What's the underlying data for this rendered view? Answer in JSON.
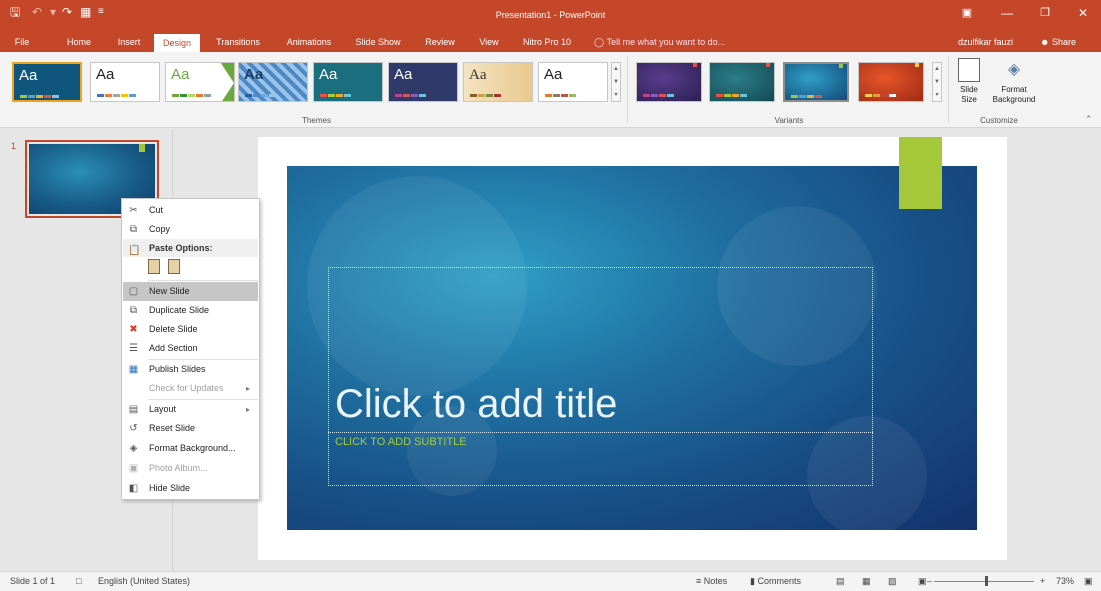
{
  "window": {
    "title": "Presentation1  -  PowerPoint",
    "user_name": "dzulfikar fauzi",
    "share_label": "Share"
  },
  "tabs": [
    {
      "label": "File"
    },
    {
      "label": "Home"
    },
    {
      "label": "Insert"
    },
    {
      "label": "Design",
      "active": true
    },
    {
      "label": "Transitions"
    },
    {
      "label": "Animations"
    },
    {
      "label": "Slide Show"
    },
    {
      "label": "Review"
    },
    {
      "label": "View"
    },
    {
      "label": "Nitro Pro 10"
    }
  ],
  "tell_me": "Tell me what you want to do...",
  "ribbon": {
    "themes_label": "Themes",
    "variants_label": "Variants",
    "customize_label": "Customize",
    "theme_aa": "Aa",
    "slide_size_label": "Slide Size",
    "format_background_label": "Format Background"
  },
  "context_menu": {
    "cut": "Cut",
    "copy": "Copy",
    "paste_options": "Paste Options:",
    "new_slide": "New Slide",
    "duplicate_slide": "Duplicate Slide",
    "delete_slide": "Delete Slide",
    "add_section": "Add Section",
    "publish_slides": "Publish Slides",
    "check_for_updates": "Check for Updates",
    "layout": "Layout",
    "reset_slide": "Reset Slide",
    "format_background": "Format Background...",
    "photo_album": "Photo Album...",
    "hide_slide": "Hide Slide"
  },
  "thumbnail": {
    "number": "1"
  },
  "slide": {
    "title_placeholder": "Click to add title",
    "subtitle_placeholder": "CLICK TO ADD SUBTITLE"
  },
  "status": {
    "slide_info": "Slide 1 of 1",
    "language": "English (United States)",
    "notes": "Notes",
    "comments": "Comments",
    "zoom": "73%"
  },
  "colors": {
    "accent": "#c5472a",
    "slide_accent": "#a4c83a",
    "slide_bg": "#1f6fa0"
  }
}
